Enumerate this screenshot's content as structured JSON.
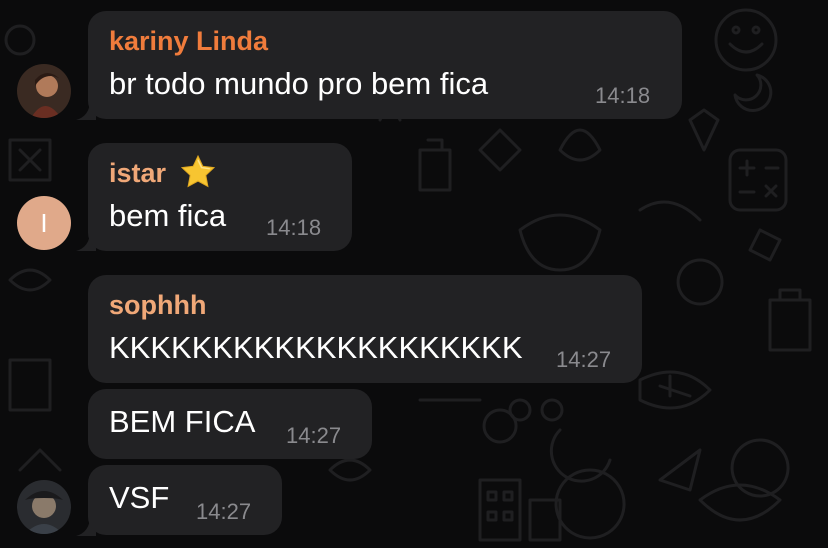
{
  "colors": {
    "bubble": "#222224",
    "background": "#0b0b0c",
    "sender_orange": "#f07c3c",
    "sender_peach": "#f0a878",
    "timestamp": "#8a8a8e",
    "avatar_i_bg": "#e0a98a"
  },
  "messages": [
    {
      "sender": "kariny Linda",
      "text": "br todo mundo pro bem fica",
      "time": "14:18",
      "avatar": "photo"
    },
    {
      "sender": "istar",
      "sender_emoji": "star-emoji",
      "text": "bem fica",
      "time": "14:18",
      "avatar_initial": "I"
    },
    {
      "sender": "sophhh",
      "text": "KKKKKKKKKKKKKKKKKKKK",
      "time": "14:27"
    },
    {
      "text": "BEM FICA",
      "time": "14:27"
    },
    {
      "text": "VSF",
      "time": "14:27",
      "avatar": "photo"
    }
  ]
}
